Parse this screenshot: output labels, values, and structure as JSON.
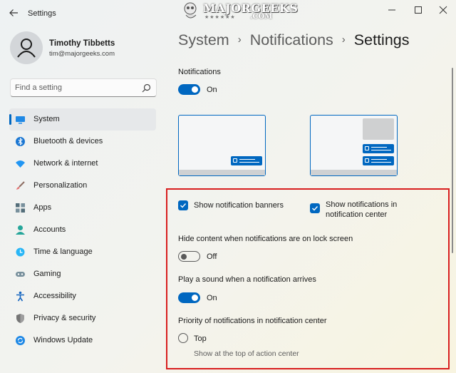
{
  "window": {
    "title": "Settings",
    "watermark": {
      "name": "MAJORGEEKS",
      "suffix": ".COM",
      "stars": "★★★★★★"
    }
  },
  "user": {
    "name": "Timothy Tibbetts",
    "email": "tim@majorgeeks.com"
  },
  "search": {
    "placeholder": "Find a setting"
  },
  "sidebar": {
    "items": [
      {
        "label": "System",
        "icon": "system-icon",
        "active": true
      },
      {
        "label": "Bluetooth & devices",
        "icon": "bluetooth-icon"
      },
      {
        "label": "Network & internet",
        "icon": "wifi-icon"
      },
      {
        "label": "Personalization",
        "icon": "brush-icon"
      },
      {
        "label": "Apps",
        "icon": "apps-icon"
      },
      {
        "label": "Accounts",
        "icon": "person-icon"
      },
      {
        "label": "Time & language",
        "icon": "clock-globe-icon"
      },
      {
        "label": "Gaming",
        "icon": "gamepad-icon"
      },
      {
        "label": "Accessibility",
        "icon": "accessibility-icon"
      },
      {
        "label": "Privacy & security",
        "icon": "shield-icon"
      },
      {
        "label": "Windows Update",
        "icon": "update-icon"
      }
    ]
  },
  "breadcrumb": {
    "part1": "System",
    "part2": "Notifications",
    "current": "Settings",
    "separator": "›"
  },
  "notifications": {
    "label": "Notifications",
    "state": "On",
    "on": true
  },
  "options": {
    "banners": {
      "label": "Show notification banners",
      "checked": true
    },
    "center": {
      "label": "Show notifications in notification center",
      "checked": true
    },
    "lock_screen": {
      "title": "Hide content when notifications are on lock screen",
      "state": "Off",
      "on": false
    },
    "sound": {
      "title": "Play a sound when a notification arrives",
      "state": "On",
      "on": true
    },
    "priority": {
      "title": "Priority of notifications in notification center",
      "option": "Top",
      "description": "Show at the top of action center",
      "selected": false
    }
  },
  "colors": {
    "accent": "#0067c0",
    "highlight": "#d81e1e",
    "active_nav": "#e6e8ea"
  }
}
